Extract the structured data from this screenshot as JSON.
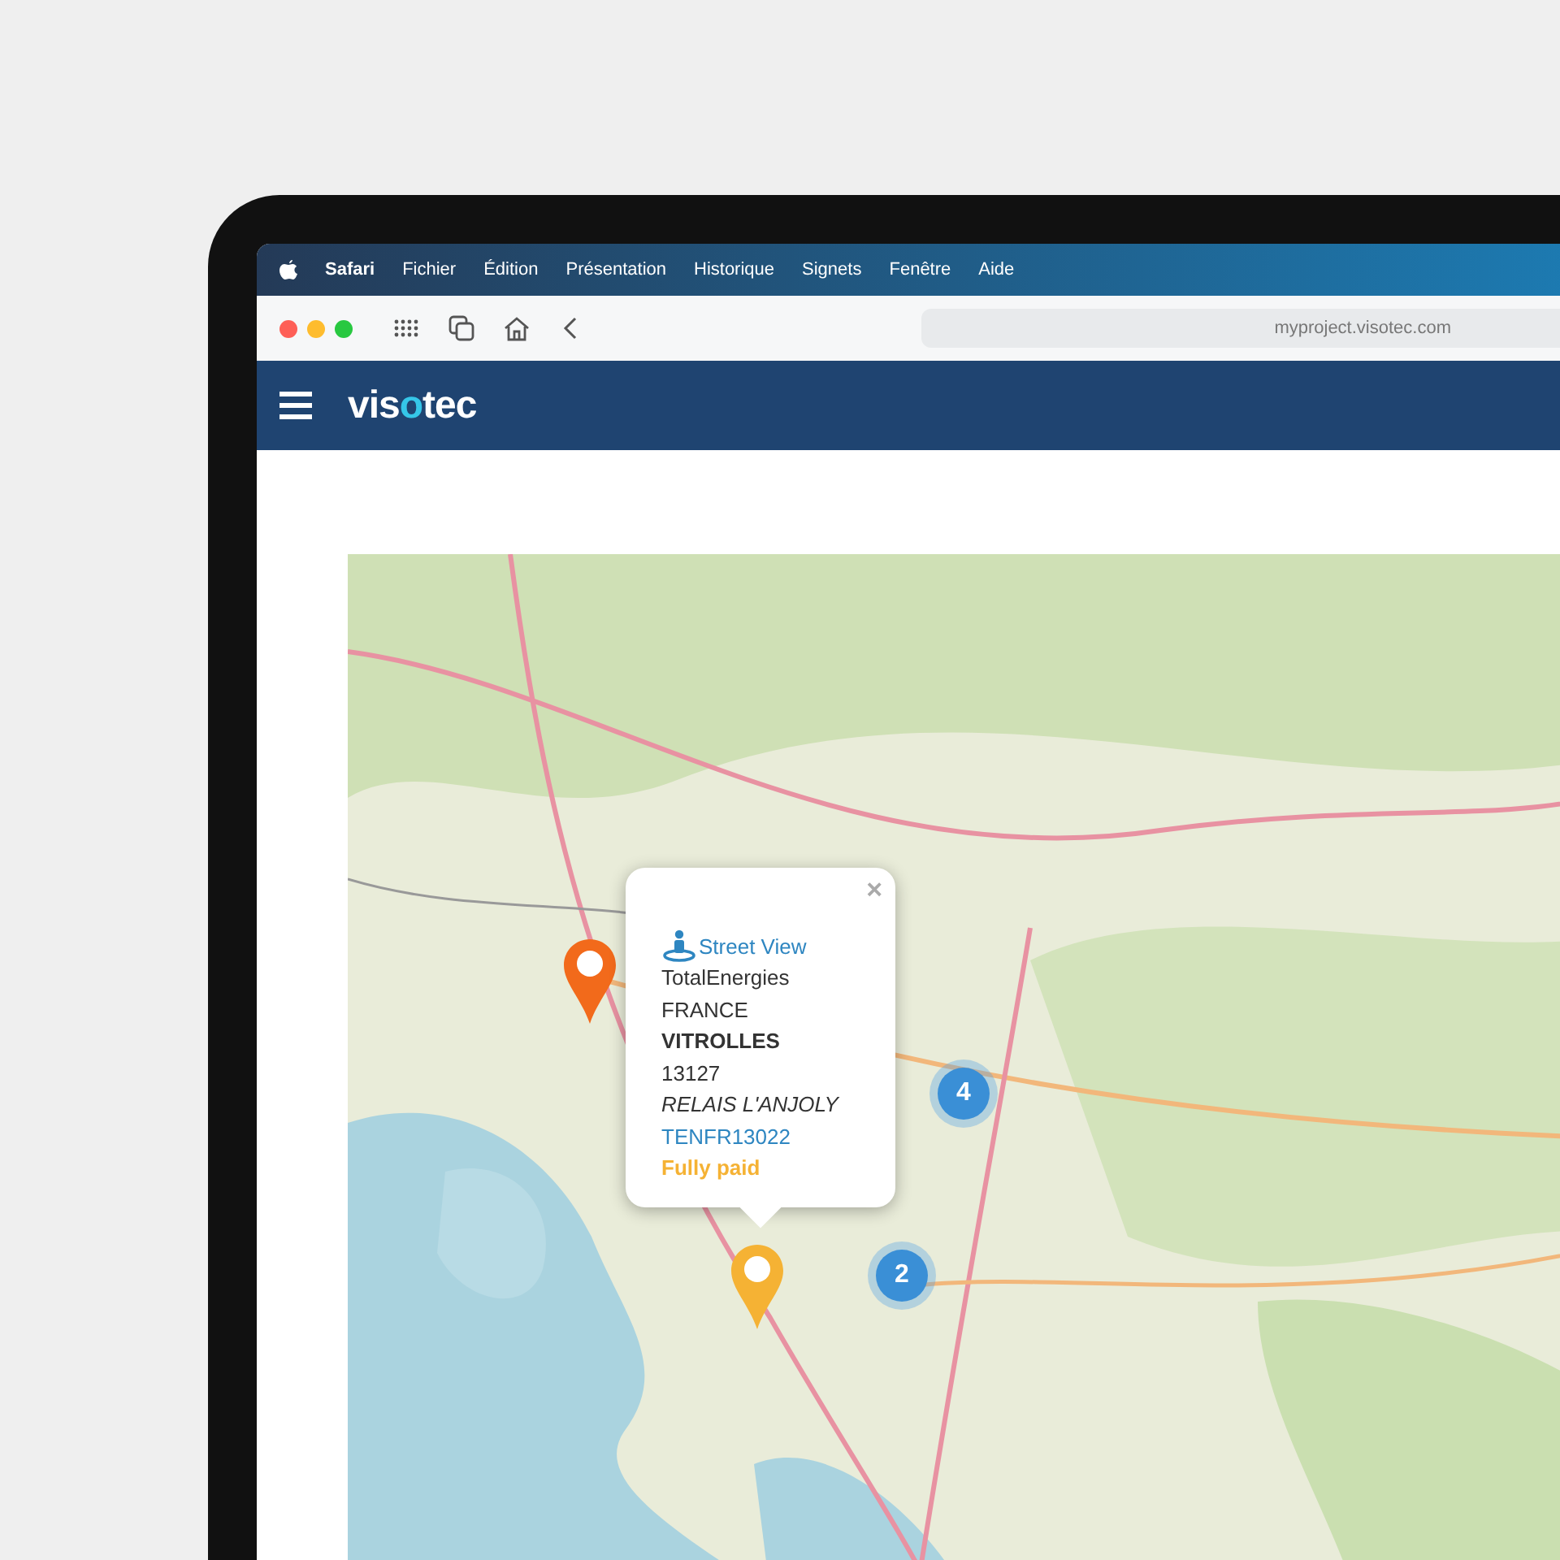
{
  "menu_bar": {
    "app": "Safari",
    "items": [
      "Fichier",
      "Édition",
      "Présentation",
      "Historique",
      "Signets",
      "Fenêtre",
      "Aide"
    ]
  },
  "browser": {
    "address": "myproject.visotec.com"
  },
  "header": {
    "logo": {
      "before": "vis",
      "accent": "o",
      "after": "tec"
    }
  },
  "map": {
    "markers": [
      {
        "color": "#f26a1b"
      },
      {
        "color": "#f5b234"
      }
    ],
    "clusters": [
      {
        "count": "4"
      },
      {
        "count": "2"
      }
    ],
    "popup": {
      "close": "×",
      "street_view": "Street View",
      "lines": [
        {
          "kind": "plain",
          "text": "TotalEnergies"
        },
        {
          "kind": "plain",
          "text": "FRANCE"
        },
        {
          "kind": "bold",
          "text": "VITROLLES"
        },
        {
          "kind": "plain",
          "text": "13127"
        },
        {
          "kind": "italic",
          "text": "RELAIS L'ANJOLY"
        },
        {
          "kind": "link",
          "text": "TENFR13022"
        },
        {
          "kind": "status",
          "text": "Fully paid"
        }
      ]
    }
  }
}
